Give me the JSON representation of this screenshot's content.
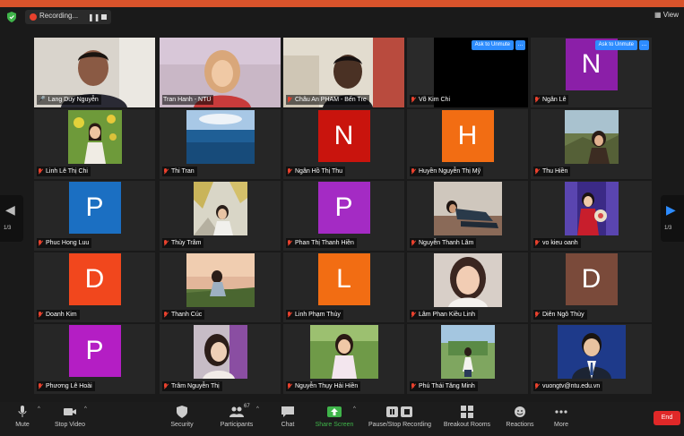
{
  "topbar": {
    "recording_label": "Recording...",
    "pause_glyph": "❚❚",
    "view_label": "View"
  },
  "nav": {
    "page_indicator_left": "1/3",
    "page_indicator_right": "1/3"
  },
  "colors": {
    "accent": "#2d8cff",
    "active_speaker": "#9bd54e",
    "muted_red": "#e8412d",
    "end_red": "#e02828",
    "share_green": "#3fb44a"
  },
  "participants": [
    {
      "name": "Lang Duy Nguyễn",
      "type": "video",
      "muted": false,
      "active": true
    },
    {
      "name": "Tran Hanh - NTU",
      "type": "video",
      "muted": false
    },
    {
      "name": "Châu An PHAM - Bến Tre",
      "type": "video",
      "muted": true
    },
    {
      "name": "Võ Kim Chi",
      "type": "dark",
      "muted": true,
      "ask_unmute": "Ask to Unmute",
      "more": "..."
    },
    {
      "name": "Ngân Lê",
      "type": "letter",
      "letter": "N",
      "color": "#8b1fa8",
      "muted": true,
      "ask_unmute": "Ask to Unmute",
      "more": "..."
    },
    {
      "name": "Linh Lê Thị Chi",
      "type": "photo",
      "muted": true
    },
    {
      "name": "Thi Tran",
      "type": "photo",
      "muted": true
    },
    {
      "name": "Ngân Hồ Thị Thu",
      "type": "letter",
      "letter": "N",
      "color": "#c9140d",
      "muted": true
    },
    {
      "name": "Huyền Nguyễn Thị Mỹ",
      "type": "letter",
      "letter": "H",
      "color": "#f26d13",
      "muted": true
    },
    {
      "name": "Thu Hiền",
      "type": "photo",
      "muted": true
    },
    {
      "name": "Phuc Hong Luu",
      "type": "letter",
      "letter": "P",
      "color": "#1b6fc2",
      "muted": true
    },
    {
      "name": "Thùy Trâm",
      "type": "photo",
      "muted": true
    },
    {
      "name": "Phan Thị Thanh Hiền",
      "type": "letter",
      "letter": "P",
      "color": "#a42bc4",
      "muted": true
    },
    {
      "name": "Nguyễn Thanh Lâm",
      "type": "photo",
      "muted": true
    },
    {
      "name": "vo kieu oanh",
      "type": "photo",
      "muted": true
    },
    {
      "name": "Doanh Kim",
      "type": "letter",
      "letter": "D",
      "color": "#f1471d",
      "muted": true
    },
    {
      "name": "Thanh Cúc",
      "type": "photo",
      "muted": true
    },
    {
      "name": "Linh Phạm Thùy",
      "type": "letter",
      "letter": "L",
      "color": "#f26d13",
      "muted": true
    },
    {
      "name": "Lâm Phan Kiều Linh",
      "type": "photo",
      "muted": true
    },
    {
      "name": "Diên Ngô Thùy",
      "type": "letter",
      "letter": "D",
      "color": "#7a4a3a",
      "muted": true
    },
    {
      "name": "Phương Lê Hoài",
      "type": "letter",
      "letter": "P",
      "color": "#b41ec4",
      "muted": true
    },
    {
      "name": "Trâm Nguyễn Thị",
      "type": "photo",
      "muted": true
    },
    {
      "name": "Nguyễn Thụy Hải Hiền",
      "type": "photo",
      "muted": true
    },
    {
      "name": "Phú Thái Tăng Minh",
      "type": "photo",
      "muted": true
    },
    {
      "name": "vuongtv@ntu.edu.vn",
      "type": "photo",
      "muted": true
    }
  ],
  "toolbar": {
    "mute": "Mute",
    "stop_video": "Stop Video",
    "security": "Security",
    "participants": "Participants",
    "participants_count": "67",
    "chat": "Chat",
    "share_screen": "Share Screen",
    "pause_stop_recording": "Pause/Stop Recording",
    "breakout_rooms": "Breakout Rooms",
    "reactions": "Reactions",
    "more": "More",
    "end": "End"
  }
}
